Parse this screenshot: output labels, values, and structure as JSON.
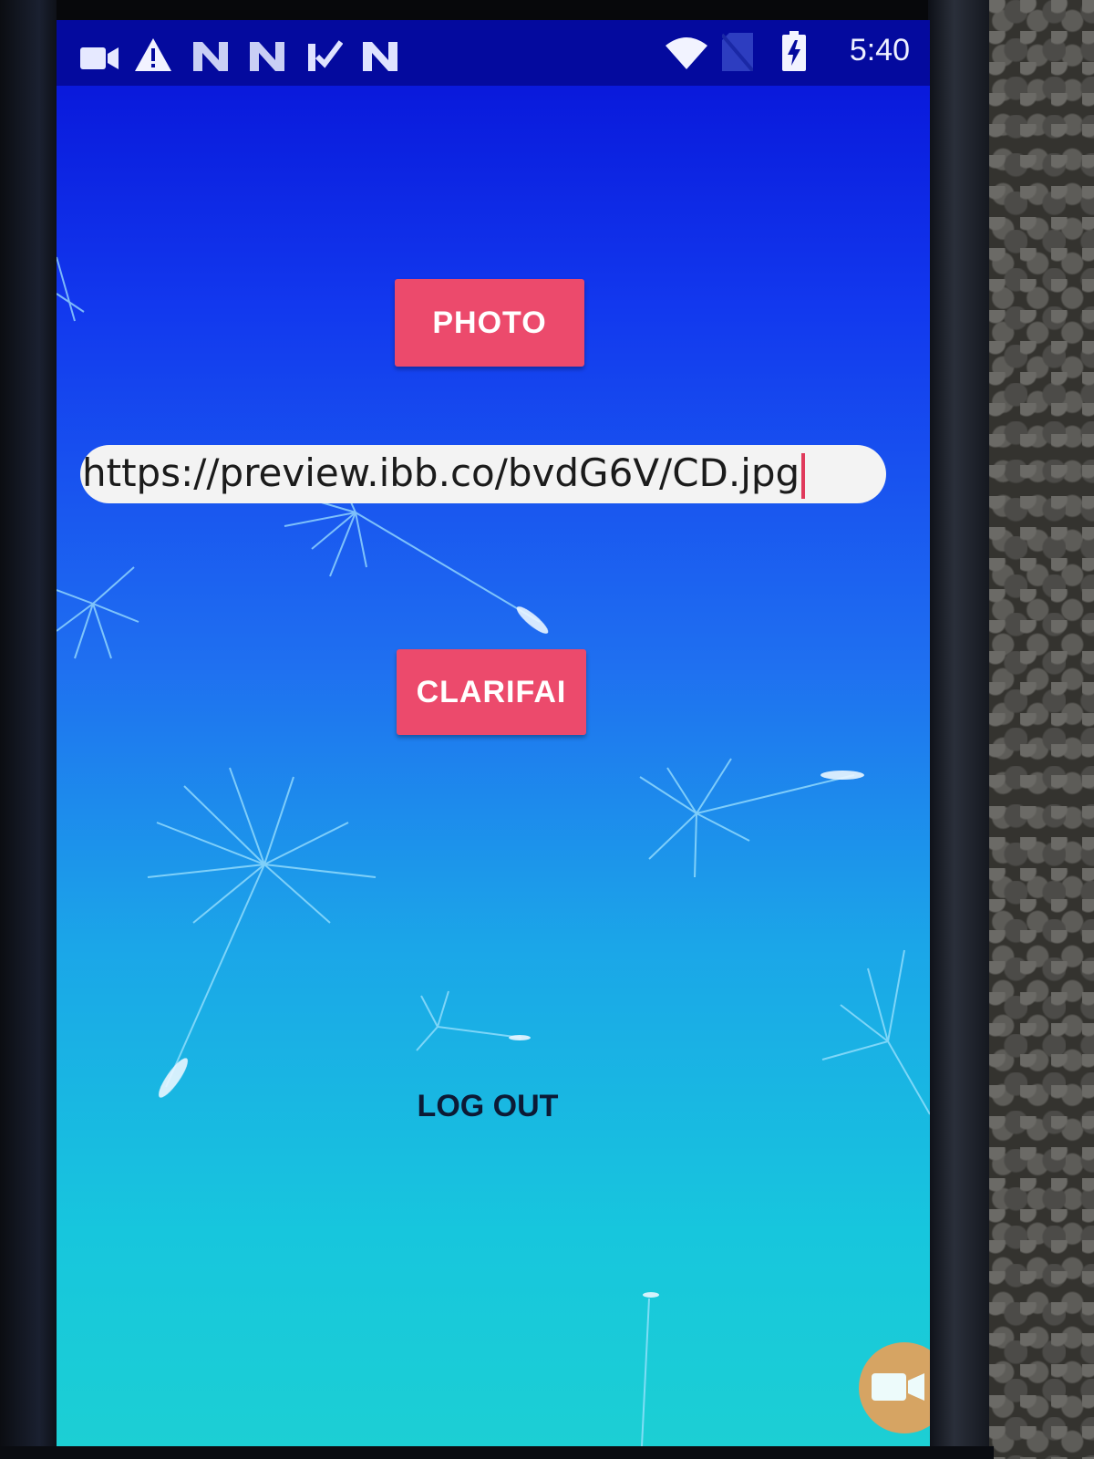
{
  "status_bar": {
    "time": "5:40",
    "icons": [
      "video-camera-icon",
      "warning-icon",
      "notification-n-icon",
      "notification-n-icon",
      "checkmark-n-icon",
      "notification-n-icon",
      "wifi-icon",
      "no-sim-icon",
      "battery-charging-icon"
    ]
  },
  "main": {
    "photo_button_label": "PHOTO",
    "url_value": "https://preview.ibb.co/bvdG6V/CD.jpg",
    "clarifai_button_label": "CLARIFAI",
    "logout_button_label": "LOG OUT"
  },
  "floating_action": {
    "icon": "video-camera-icon"
  },
  "colors": {
    "status_bar": "#040a9e",
    "button_pink": "#ec4a6c",
    "gradient_top": "#0710d6",
    "gradient_bottom": "#1ccfd4"
  }
}
